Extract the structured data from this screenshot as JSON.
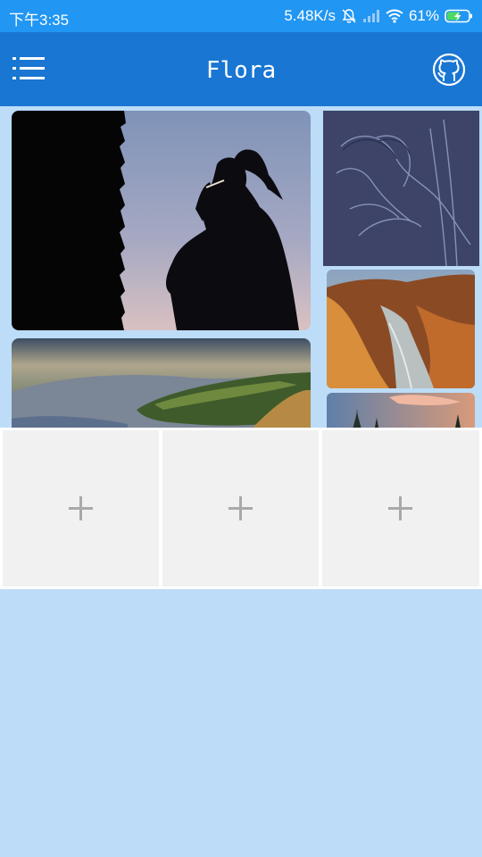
{
  "status_bar": {
    "time": "下午3:35",
    "network_speed": "5.48K/s",
    "battery_percent": "61%",
    "icons": [
      "bell-off-icon",
      "cellular-signal-icon",
      "wifi-icon",
      "battery-charging-icon"
    ]
  },
  "app_bar": {
    "title": "Flora",
    "menu_icon": "menu-icon",
    "github_icon": "github-icon"
  },
  "gallery": {
    "images": [
      "silhouette-photo",
      "aerial-landscape-photo",
      "embossed-portrait-photo",
      "canyon-river-photo",
      "pine-sunset-photo"
    ]
  },
  "upload_slots": [
    {
      "icon": "plus-icon"
    },
    {
      "icon": "plus-icon"
    },
    {
      "icon": "plus-icon"
    }
  ],
  "colors": {
    "status_bar": "#2196f3",
    "app_bar": "#1976d2",
    "background": "#bcdcf8",
    "slot": "#f1f1f1"
  }
}
